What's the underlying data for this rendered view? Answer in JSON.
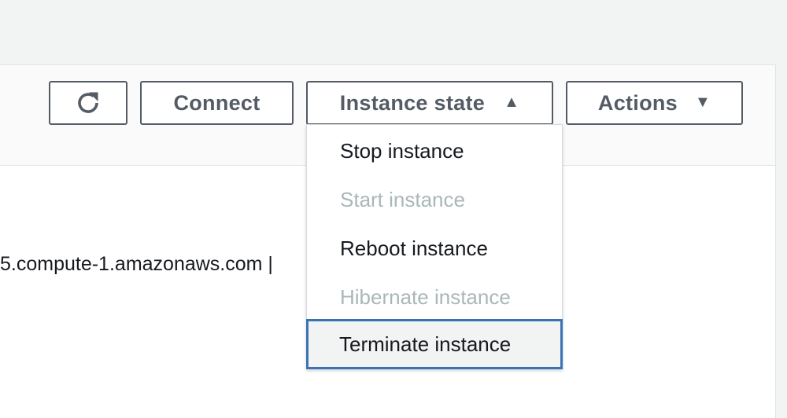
{
  "toolbar": {
    "refresh_icon": "refresh-icon",
    "connect_label": "Connect",
    "instance_state_label": "Instance state",
    "instance_state_caret": "▲",
    "actions_label": "Actions",
    "actions_caret": "▼"
  },
  "content": {
    "dns_text": "5.compute-1.amazonaws.com |"
  },
  "instance_state_menu": {
    "items": [
      {
        "label": "Stop instance",
        "enabled": true
      },
      {
        "label": "Start instance",
        "enabled": false
      },
      {
        "label": "Reboot instance",
        "enabled": true
      },
      {
        "label": "Hibernate instance",
        "enabled": false
      },
      {
        "label": "Terminate instance",
        "enabled": true,
        "focused": true
      }
    ]
  },
  "colors": {
    "button_border": "#545b64",
    "disabled_text": "#aab7b8",
    "focus_border": "#3a73b5"
  }
}
